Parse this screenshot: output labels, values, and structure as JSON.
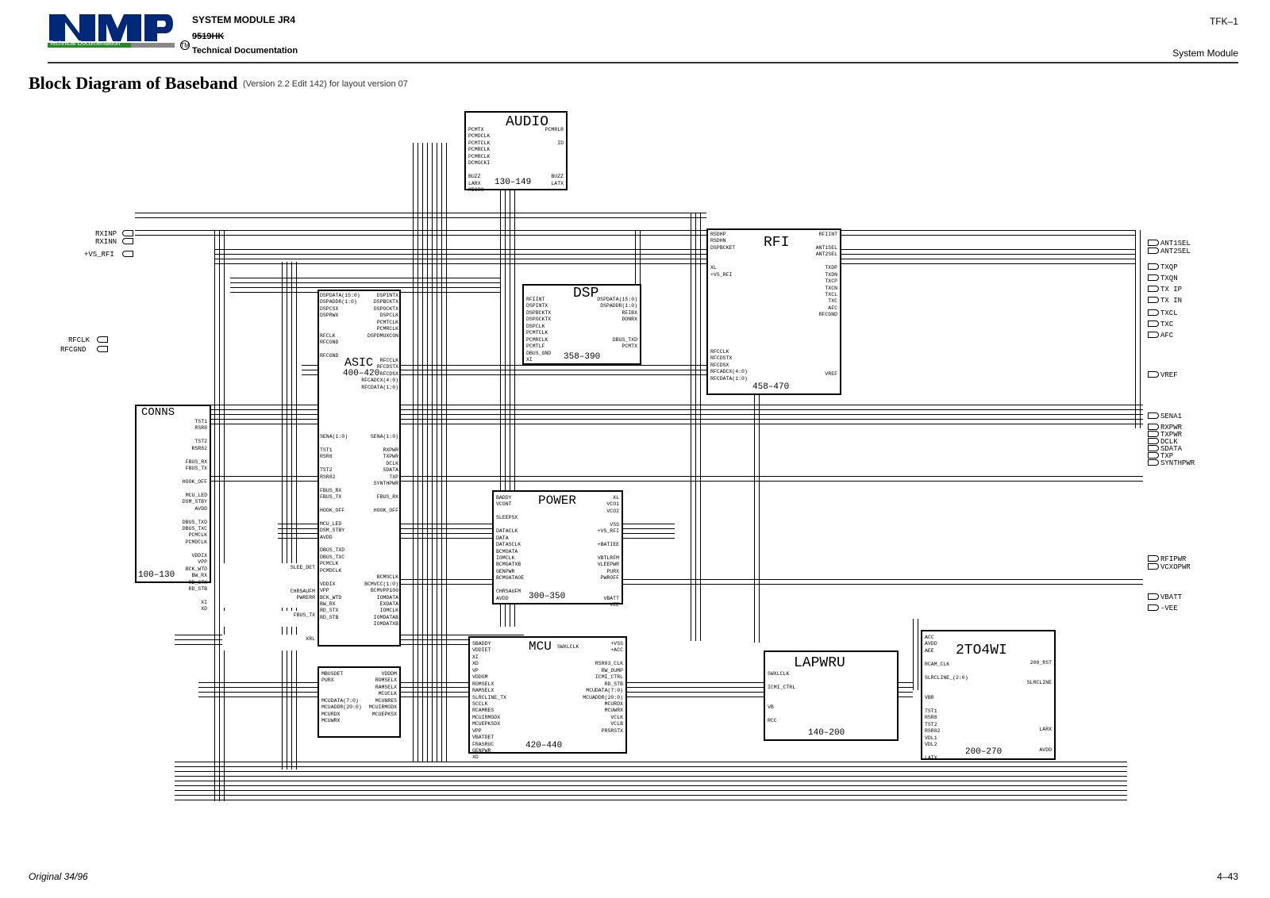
{
  "header": {
    "system_module": "SYSTEM MODULE JR4",
    "code": "9519HK",
    "tech_doc": "Technical Documentation",
    "tfk": "TFK–1",
    "sysmod": "System Module",
    "logo_text": "Technical Documentation",
    "tm": "TM"
  },
  "title": {
    "main": "Block Diagram of Baseband",
    "sub": "(Version 2.2 Edit 142) for layout version 07"
  },
  "footer": {
    "left": "Original 34/96",
    "right": "4–43"
  },
  "blocks": {
    "audio": {
      "name": "AUDIO",
      "range": "130–149",
      "pins_left": "PCMTX\nPCMDCLK\nPCMTCLK\nPCMRCLK\nPCMRCLK\nDCMOCKI\n\nBUZZ\nLARX\nMICRO",
      "pins_right": "PCMRLR\n\nID\n\n\n\n\nBUZZ\nLATX"
    },
    "asic": {
      "name": "ASIC",
      "range": "400–420",
      "pins_left_top": "DSPDATA(15:0)\nDSPADDR(1:0)\nDSPCSX\nDSPRWX\n\n\nRFCLK\nRFCGND\n\nRFCGND",
      "pins_right_top": "DSPINTX\nDSPBCKTX\nDSPOCKTX\nDSPCLK\nPCMTCLK\nPCMRCLK\nDSPDMUXCON",
      "pins_right_mid": "RFCCLK\nRFCDSTX\nRFCDSX\nRFCADCX(4:0)\nRFCDATA(1:0)",
      "pins_left_bot": "SENA(1:0)\n\nTST1\nRSR8\n\nTST2\nRSR82\n\nFBUS_RX\nFBUS_TX\n\nHOOK_OFF\n\nMCU_LED\nDSM_STBY\nAVDD\n\nDBUS_TXD\nDBUS_TXC\nPCMCLK\nPCMDCLK\n\nVDDIX\nVPP\nBCK_WTD\nBW_RX\nRD_STX\nRD_STB",
      "pins_right_bot": "SENA(1:0)\n\nRXPWR\nTXPWR\nDCLK\nSDATA\nTXP\nSYNTHPWR\n\nFBUS_RX\n\nHOOK_OFF\n\n\n\n\n\n\n\n\n\nBCMOCLK\nBCMVCC(1:0)\nBCMVPP100\nIOMDATA\nEXDATA\nIOMCLK\nIOMDATAB\nIOMDATXB",
      "pins_sleep": "SLEE_DET",
      "pins_pwrerr": "CHRSAUFM\nPWRERR",
      "pins_fbus": "FBUS_TX",
      "pins_xrl": "XRL",
      "pins_mcu_left": "MBUSDET\nPURX\n\n\nMCUDATA(7:0)\nMCUADDR(20:0)\nMCURDX\nMCUWRX",
      "pins_mcu_right": "VDDDM\nROMSELX\nRAMSELX\nMCUCLK\nMCUNRES\nMCUIRMODX\nMCUEPKSX"
    },
    "dsp": {
      "name": "DSP",
      "range": "358–390",
      "pins_left": "RFIINT\nDSPINTX\nDSPBCKTX\nDSPOCKTX\nDSPCLK\nPCMTCLK\nPCMRCLK\nPCMTLF\nDBUS_GND\nXI",
      "pins_right": "DSPDATA(15:0)\nDSPADDR(1:0)\nRFIBX\nDONRX\n\n\nDBUS_TXD\nPCMTX"
    },
    "rfi": {
      "name": "RFI",
      "range": "458–470",
      "pins_left_top": "RSDHP\nRSDHN\nDSPBCKET\n\n\nXL\n+VS_RFI",
      "pins_right_top": "RFIINT\n\nANT1SEL\nANT2SEL\n\nTXDP\nTXDN\nTXCP\nTXCN\nTXCL\nTXC\nAFC\nRFCGND",
      "pins_left_bot": "RFCCLK\nRFCDSTX\nRFCDSX\nRFCADCX(4:0)\nRFCDATA(1:0)",
      "pins_right_bot": "VREF"
    },
    "conns": {
      "name": "CONNS",
      "range": "100–130",
      "pins": "TST1\nRSR8\n\nTST2\nRSR82\n\nFBUS_RX\nFBUS_TX\n\nHOOK_OFF\n\nMCU_LED\nDSM_STBY\nAVDD\n\nDBUS_TXD\nDBUS_TXC\nPCMCLK\nPCMDCLK\n\nVDDIX\nVPP\nBCK_WTD\nBW_RX\nRD_STX\nRD_STB\n\nXI\nXD"
    },
    "power": {
      "name": "POWER",
      "range": "300–350",
      "pins_left": "BADDY\nVCONT\n\nSLEEPSX\n\nDATACLK\nDATA\nDATASCLK\nBCMOATA\nIOMCLK\nBCMOATXB\nGENPWR\nBCMOATAOE\n\nCHRSAUFM\nAVDD",
      "pins_right": "XL\nVCO1\nVCO2\n\nVSS\n+VS_RFI\n\n+BATIEE\n\nVBTLRFM\nVLEEPWR\nPURX\nPWROFF\n\n\nVBATT\nVEE"
    },
    "mcu": {
      "name": "MCU",
      "range": "420–440",
      "pins_left": "SBADDY\nVDDIET\nXI\nXD\nVP\nVDDOM\nROMSELX\nRAMSELX\nSLRCLINE_TX\nSCCLK\nRCAMRES\nMCUIRMODX\nMCUEPKSDX\nVPP\nVBATDET\nFRASRUC\nGENPWR\nXD",
      "pins_center": "SWXLCLK",
      "pins_right": "+VSS\n+ACC\n\nRSR03_CLK\nRW_DUMP\nICMI_CTRL\nRD_STB\nMCUDATA(7:0)\nMCUADDR(20:0)\nMCURDX\nMCUWRX\nVCLK\nVCLB\nPRSRSTX"
    },
    "lapwru": {
      "name": "LAPWRU",
      "range": "140–200",
      "pins_left": "SWXLCLK\n\nICMI_CTRL\n\n\nVB\n\nRCC",
      "pins_right": ""
    },
    "twowi": {
      "name": "2TO4WI",
      "range": "200–270",
      "pins_left": "ACC\nAVDD\nAEE\n\nRCAM_CLK\n\nSLRCLINE_(2:0)\n\n\nVBR\n\nTST1\nRSR8\nTST2\nRSR82\nVDL1\nVDL2\n\nLATX",
      "pins_right": "200_RST\n\n\nSLRCLINE\n\n\n\n\n\n\nLARX\n\n\nAVDD"
    },
    "ports_left": {
      "rxinp": "RXINP",
      "rxinn": "RXINN",
      "vs_rfi": "+VS_RFI",
      "rfclk": "RFCLK",
      "rfcgnd": "RFCGND"
    },
    "ports_right": {
      "ant1sel": "ANT1SEL",
      "ant2sel": "ANT2SEL",
      "txqp": "TXQP",
      "txqn": "TXQN",
      "txip": "TX IP",
      "txin": "TX IN",
      "txcl": "TXCL",
      "txc": "TXC",
      "afc": "AFC",
      "vref": "VREF",
      "sena1": "SENA1",
      "rxpwr": "RXPWR",
      "txpwr": "TXPWR",
      "dclk": "DCLK",
      "sdata": "SDATA",
      "txp": "TXP",
      "synthpwr": "SYNTHPWR",
      "rfipwr": "RFIPWR",
      "vcxopwr": "VCXOPWR",
      "vbatt": "VBATT",
      "vee": "-VEE"
    }
  }
}
